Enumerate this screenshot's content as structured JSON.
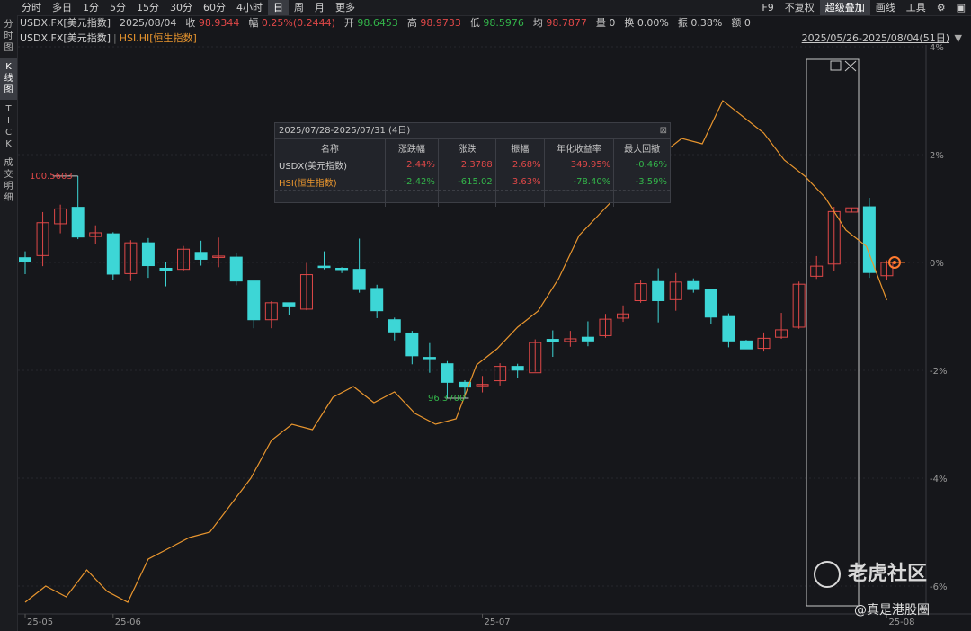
{
  "toolbar": {
    "periods": [
      "分时",
      "多日",
      "1分",
      "5分",
      "15分",
      "30分",
      "60分",
      "4小时",
      "日",
      "周",
      "月",
      "更多"
    ],
    "active_period": "日",
    "right_tools": [
      "F9",
      "不复权",
      "超级叠加",
      "画线",
      "工具"
    ],
    "active_tool": "超级叠加"
  },
  "left_nav": {
    "items": [
      "分时图",
      "K线图",
      "TICK",
      "成交明细"
    ],
    "active": "K线图"
  },
  "quote": {
    "symbol": "USDX.FX[美元指数]",
    "date": "2025/08/04",
    "close_label": "收",
    "close": "98.9344",
    "change_label": "幅",
    "change": "0.25%(0.2444)",
    "open_label": "开",
    "open": "98.6453",
    "high_label": "高",
    "high": "98.9733",
    "low_label": "低",
    "low": "98.5976",
    "avg_label": "均",
    "avg": "98.7877",
    "volume": "量 0",
    "turnover": "换 0.00%",
    "amplitude": "振 0.38%",
    "amount": "额 0"
  },
  "legend": {
    "series1": "USDX.FX[美元指数]",
    "series2": "HSI.HI[恒生指数]",
    "range": "2025/05/26-2025/08/04(51日)"
  },
  "stats_popup": {
    "title": "2025/07/28-2025/07/31 (4日)",
    "headers": [
      "名称",
      "涨跌幅",
      "涨跌",
      "振幅",
      "年化收益率",
      "最大回撤"
    ],
    "rows": [
      {
        "name": "USDX(美元指数)",
        "change_pct": "2.44%",
        "change": "2.3788",
        "amplitude": "2.68%",
        "annualized": "349.95%",
        "max_drawdown": "-0.46%"
      },
      {
        "name": "HSI(恒生指数)",
        "change_pct": "-2.42%",
        "change": "-615.02",
        "amplitude": "3.63%",
        "annualized": "-78.40%",
        "max_drawdown": "-3.59%"
      }
    ]
  },
  "watermark": {
    "brand": "老虎社区",
    "author": "@真是港股圈"
  },
  "colors": {
    "up": "#e04848",
    "down": "#3dd6d6",
    "hsi": "#e8952e",
    "bg": "#16171b"
  },
  "chart_data": {
    "type": "candlestick+line",
    "y_axis_right_ticks": [
      "4%",
      "2%",
      "0%",
      "-2%",
      "-4%",
      "-6%"
    ],
    "y_axis_right_values": [
      4,
      2,
      0,
      -2,
      -4,
      -6
    ],
    "x_axis_ticks": [
      "25-05",
      "25-06",
      "25-07",
      "25-08"
    ],
    "annotations": {
      "high": "100.5603",
      "low": "96.3700"
    },
    "usdx_candles": [
      {
        "o": 99.02,
        "c": 98.95,
        "h": 99.14,
        "l": 98.71
      },
      {
        "o": 99.06,
        "c": 99.68,
        "h": 99.88,
        "l": 98.86
      },
      {
        "o": 99.66,
        "c": 99.94,
        "h": 100.02,
        "l": 99.48
      },
      {
        "o": 99.97,
        "c": 99.41,
        "h": 100.56,
        "l": 99.37
      },
      {
        "o": 99.42,
        "c": 99.49,
        "h": 99.63,
        "l": 99.28
      },
      {
        "o": 99.47,
        "c": 98.71,
        "h": 99.5,
        "l": 98.6
      },
      {
        "o": 98.72,
        "c": 99.3,
        "h": 99.35,
        "l": 98.58
      },
      {
        "o": 99.3,
        "c": 98.87,
        "h": 99.39,
        "l": 98.64
      },
      {
        "o": 98.82,
        "c": 98.77,
        "h": 98.93,
        "l": 98.48
      },
      {
        "o": 98.8,
        "c": 99.18,
        "h": 99.24,
        "l": 98.76
      },
      {
        "o": 99.12,
        "c": 98.99,
        "h": 99.34,
        "l": 98.87
      },
      {
        "o": 99.04,
        "c": 99.05,
        "h": 99.4,
        "l": 98.84
      },
      {
        "o": 99.03,
        "c": 98.58,
        "h": 99.11,
        "l": 98.5
      },
      {
        "o": 98.58,
        "c": 97.85,
        "h": 98.58,
        "l": 97.69
      },
      {
        "o": 97.85,
        "c": 98.17,
        "h": 98.2,
        "l": 97.69
      },
      {
        "o": 98.17,
        "c": 98.11,
        "h": 98.12,
        "l": 97.93
      },
      {
        "o": 98.05,
        "c": 98.7,
        "h": 98.92,
        "l": 98.03
      },
      {
        "o": 98.86,
        "c": 98.84,
        "h": 99.14,
        "l": 98.8
      },
      {
        "o": 98.82,
        "c": 98.8,
        "h": 98.84,
        "l": 98.73
      },
      {
        "o": 98.8,
        "c": 98.42,
        "h": 99.38,
        "l": 98.36
      },
      {
        "o": 98.44,
        "c": 98.02,
        "h": 98.51,
        "l": 97.88
      },
      {
        "o": 97.85,
        "c": 97.62,
        "h": 97.89,
        "l": 97.46
      },
      {
        "o": 97.6,
        "c": 97.17,
        "h": 97.64,
        "l": 97.01
      },
      {
        "o": 97.14,
        "c": 97.12,
        "h": 97.41,
        "l": 96.85
      },
      {
        "o": 97.02,
        "c": 96.67,
        "h": 97.07,
        "l": 96.37
      },
      {
        "o": 96.67,
        "c": 96.58,
        "h": 96.71,
        "l": 96.37
      },
      {
        "o": 96.61,
        "c": 96.63,
        "h": 96.79,
        "l": 96.48
      },
      {
        "o": 96.7,
        "c": 96.97,
        "h": 97.03,
        "l": 96.61
      },
      {
        "o": 96.97,
        "c": 96.9,
        "h": 97.02,
        "l": 96.75
      },
      {
        "o": 96.85,
        "c": 97.42,
        "h": 97.48,
        "l": 96.87
      },
      {
        "o": 97.48,
        "c": 97.43,
        "h": 97.65,
        "l": 97.15
      },
      {
        "o": 97.44,
        "c": 97.49,
        "h": 97.64,
        "l": 97.34
      },
      {
        "o": 97.52,
        "c": 97.45,
        "h": 97.82,
        "l": 97.35
      },
      {
        "o": 97.55,
        "c": 97.86,
        "h": 97.96,
        "l": 97.51
      },
      {
        "o": 97.88,
        "c": 97.96,
        "h": 98.12,
        "l": 97.81
      },
      {
        "o": 98.21,
        "c": 98.53,
        "h": 98.59,
        "l": 98.17
      },
      {
        "o": 98.57,
        "c": 98.21,
        "h": 98.82,
        "l": 97.8
      },
      {
        "o": 98.23,
        "c": 98.56,
        "h": 98.73,
        "l": 98.02
      },
      {
        "o": 98.57,
        "c": 98.42,
        "h": 98.63,
        "l": 98.36
      },
      {
        "o": 98.42,
        "c": 97.9,
        "h": 98.43,
        "l": 97.77
      },
      {
        "o": 97.91,
        "c": 97.45,
        "h": 97.97,
        "l": 97.33
      },
      {
        "o": 97.45,
        "c": 97.3,
        "h": 97.47,
        "l": 97.33
      },
      {
        "o": 97.31,
        "c": 97.5,
        "h": 97.61,
        "l": 97.25
      },
      {
        "o": 97.52,
        "c": 97.66,
        "h": 97.98,
        "l": 97.49
      },
      {
        "o": 97.71,
        "c": 98.52,
        "h": 98.57,
        "l": 97.68
      },
      {
        "o": 98.67,
        "c": 98.86,
        "h": 99.05,
        "l": 98.62
      },
      {
        "o": 98.9,
        "c": 99.89,
        "h": 99.98,
        "l": 98.77
      },
      {
        "o": 99.88,
        "c": 99.96,
        "h": 99.96,
        "l": 99.87
      },
      {
        "o": 99.98,
        "c": 98.74,
        "h": 100.15,
        "l": 98.64
      },
      {
        "o": 98.68,
        "c": 98.93,
        "h": 98.97,
        "l": 98.6
      }
    ],
    "hsi_percent": [
      -6.3,
      -6.0,
      -6.2,
      -5.7,
      -6.1,
      -6.3,
      -5.5,
      -5.3,
      -5.1,
      -5.0,
      -4.5,
      -4.0,
      -3.3,
      -3.0,
      -3.1,
      -2.5,
      -2.3,
      -2.6,
      -2.4,
      -2.8,
      -3.0,
      -2.9,
      -1.9,
      -1.6,
      -1.2,
      -0.9,
      -0.3,
      0.5,
      0.9,
      1.3,
      1.7,
      2.0,
      2.3,
      2.2,
      3.0,
      2.7,
      2.4,
      1.9,
      1.6,
      1.2,
      0.6,
      0.3,
      -0.7
    ]
  }
}
